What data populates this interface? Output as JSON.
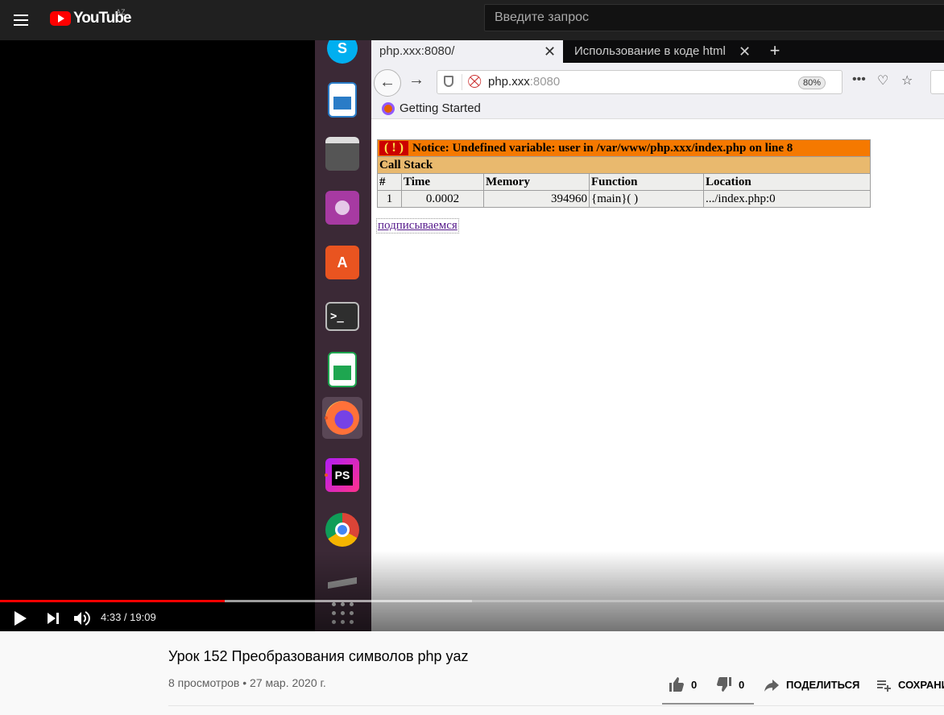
{
  "masthead": {
    "logo_text": "YouTube",
    "country_code": "AZ",
    "search_placeholder": "Введите запрос"
  },
  "browser": {
    "tabs": [
      {
        "title": "php.xxx:8080/"
      },
      {
        "title": "Использование в коде html"
      }
    ],
    "url_host": "php.xxx",
    "url_port": ":8080",
    "zoom": "80%",
    "bookmark": "Getting Started",
    "notice": {
      "badge": "( ! )",
      "message": "Notice: Undefined variable: user in /var/www/php.xxx/index.php on line 8"
    },
    "call_stack_label": "Call Stack",
    "columns": [
      "#",
      "Time",
      "Memory",
      "Function",
      "Location"
    ],
    "rows": [
      {
        "num": "1",
        "time": "0.0002",
        "memory": "394960",
        "function": "{main}( )",
        "location": ".../index.php:0"
      }
    ],
    "link_text": "подписываемся"
  },
  "player": {
    "current_time": "4:33",
    "duration": "19:09",
    "time_display": "4:33 / 19:09",
    "progress_fraction": 0.238,
    "buffered_fraction": 0.5
  },
  "video": {
    "title": "Урок 152 Преобразования символов php yaz",
    "meta": "8 просмотров • 27 мар. 2020 г.",
    "likes": "0",
    "dislikes": "0",
    "share_label": "ПОДЕЛИТЬСЯ",
    "save_label": "СОХРАНИТЬ"
  },
  "colors": {
    "youtube_red": "#ff0000",
    "masthead_bg": "#202020",
    "xdebug_orange": "#f57900",
    "xdebug_tan": "#e9b96e"
  }
}
